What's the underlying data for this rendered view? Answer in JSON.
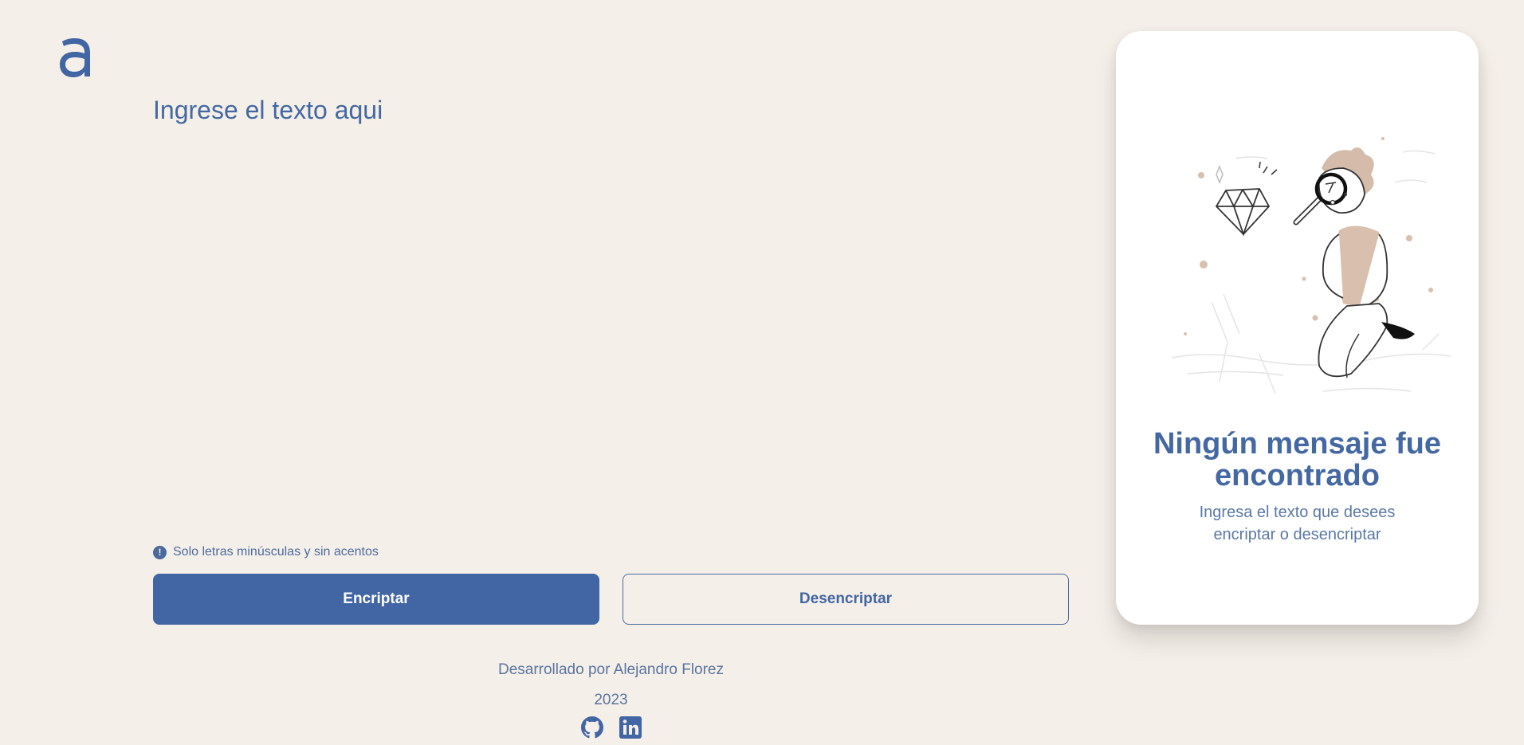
{
  "brand": {
    "logo_icon": "alura-a-logo-icon",
    "accent_color": "#4266a3",
    "background_color": "#f5efe9"
  },
  "input": {
    "placeholder": "Ingrese el texto aqui",
    "value": ""
  },
  "hint": {
    "icon": "exclamation-circle-icon",
    "text": "Solo letras minúsculas y sin acentos"
  },
  "actions": {
    "encrypt_label": "Encriptar",
    "decrypt_label": "Desencriptar"
  },
  "footer": {
    "credit": "Desarrollado por Alejandro Florez",
    "year": "2023",
    "socials": [
      {
        "icon": "github-icon"
      },
      {
        "icon": "linkedin-icon"
      }
    ]
  },
  "output_card": {
    "illustration": "person-with-magnifier-diamond-illustration",
    "title": "Ningún mensaje fue encontrado",
    "subtitle": "Ingresa el texto que desees encriptar o desencriptar"
  }
}
